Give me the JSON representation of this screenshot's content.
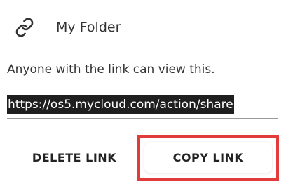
{
  "header": {
    "icon": "link-icon",
    "folder_name": "My Folder"
  },
  "description": "Anyone with the link can view this.",
  "share_link": {
    "url": "https://os5.mycloud.com/action/share"
  },
  "actions": {
    "delete_label": "DELETE LINK",
    "copy_label": "COPY LINK"
  },
  "colors": {
    "highlight_border": "#e23b3b",
    "url_selection_bg": "#1f1f1f"
  }
}
